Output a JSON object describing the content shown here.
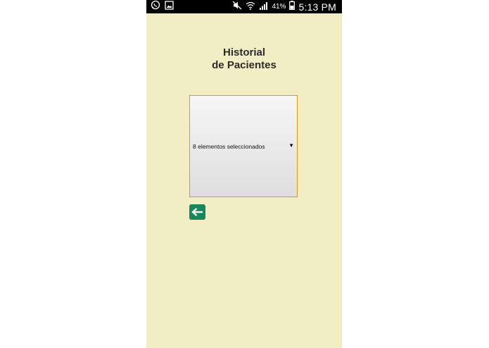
{
  "status_bar": {
    "battery": "41%",
    "time": "5:13 PM"
  },
  "page": {
    "title_line1": "Historial",
    "title_line2": "de Pacientes"
  },
  "select": {
    "selected_label": "8 elementos seleccionados",
    "arrow_glyph": "▼"
  },
  "back_button": {
    "icon": "arrow-left-icon"
  },
  "colors": {
    "background": "#f1edc5",
    "select_border": "#d39a2a",
    "back_button": "#18875a",
    "status_bar": "#000000"
  }
}
